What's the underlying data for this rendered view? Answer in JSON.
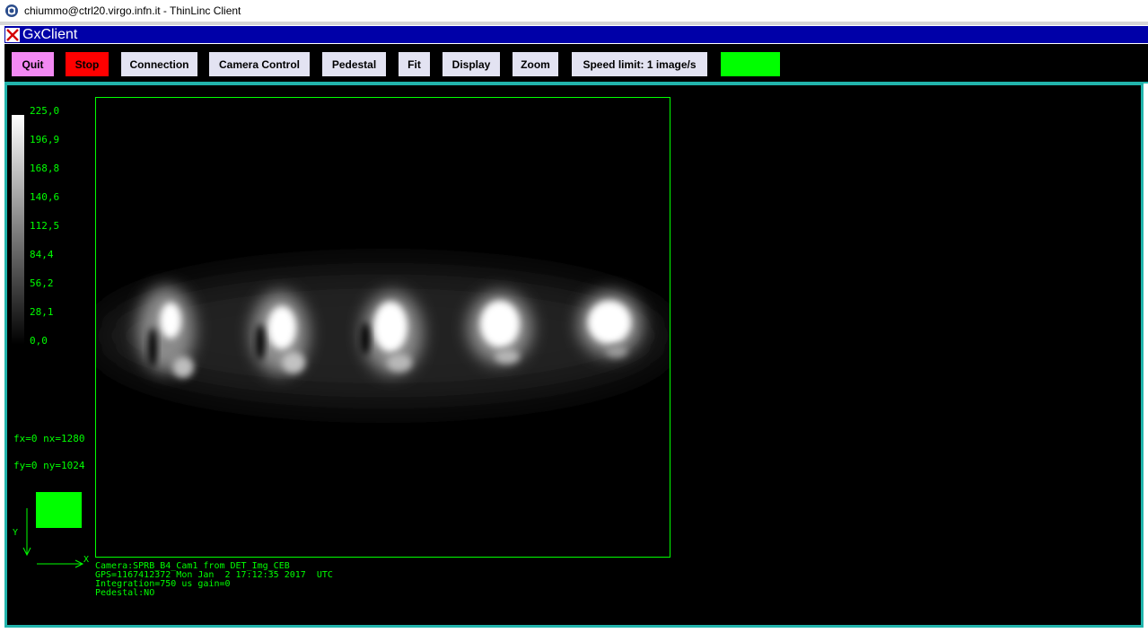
{
  "outer_window": {
    "title": "chiummo@ctrl20.virgo.infn.it - ThinLinc Client"
  },
  "gx_window": {
    "title": "GxClient"
  },
  "toolbar": {
    "quit": "Quit",
    "stop": "Stop",
    "connection": "Connection",
    "camera_control": "Camera Control",
    "pedestal": "Pedestal",
    "fit": "Fit",
    "display": "Display",
    "zoom": "Zoom",
    "speed_limit": "Speed limit: 1 image/s"
  },
  "colors": {
    "accent": "#22b4ac",
    "title_bar": "#0000a8",
    "text_green": "#00ff00",
    "quit_bg": "#f389f3",
    "stop_bg": "#ff0000",
    "status_indicator": "#00ff00"
  },
  "color_scale": {
    "labels": [
      "225,0",
      "196,9",
      "168,8",
      "140,6",
      "112,5",
      "84,4",
      "56,2",
      "28,1",
      "0,0"
    ]
  },
  "image_info": {
    "fx": "fx=0 nx=1280",
    "fy": "fy=0 ny=1024",
    "axis_y": "Y",
    "axis_x": "X"
  },
  "metadata": {
    "camera": "Camera:SPRB_B4_Cam1 from DET_Img_CEB",
    "gps": "GPS=1167412372 Mon Jan  2 17:12:35 2017  UTC",
    "integration": "Integration=750 us gain=0",
    "pedestal": "Pedestal:NO"
  },
  "icons": {
    "app": "thinlinc-app-icon",
    "close": "close-x-icon"
  }
}
